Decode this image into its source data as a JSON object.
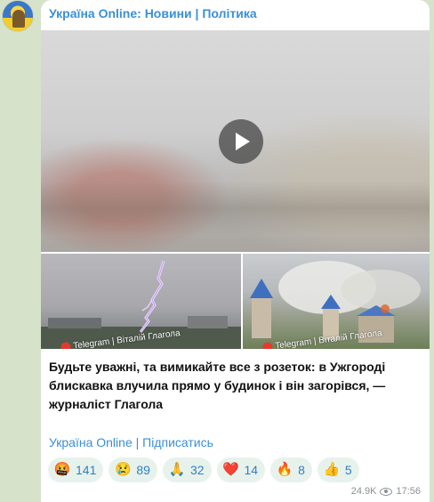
{
  "channel": {
    "name": "Україна Online: Новини | Політика",
    "avatar_icon": "channel-avatar"
  },
  "media": {
    "video_play_icon": "play-icon",
    "photos": [
      {
        "watermark": "Telegram | Віталій Глагола"
      },
      {
        "watermark": "Telegram | Віталій Глагола"
      }
    ]
  },
  "post": {
    "text": "Будьте уважні, та вимикайте все з розеток: в Ужгороді блискавка влучила прямо у будинок і він загорівся, — журналіст Глагола"
  },
  "footer": {
    "channel_link": "Україна Online",
    "separator": "|",
    "subscribe_link": "Підписатись"
  },
  "reactions": [
    {
      "emoji": "🤬",
      "count": "141"
    },
    {
      "emoji": "😢",
      "count": "89"
    },
    {
      "emoji": "🙏",
      "count": "32"
    },
    {
      "emoji": "❤️",
      "count": "14"
    },
    {
      "emoji": "🔥",
      "count": "8"
    },
    {
      "emoji": "👍",
      "count": "5"
    }
  ],
  "meta": {
    "views": "24.9K",
    "time": "17:56"
  },
  "colors": {
    "link": "#3a8fd6",
    "reaction_bg": "#e8f2ec",
    "chat_bg": "#d6e2ca"
  }
}
